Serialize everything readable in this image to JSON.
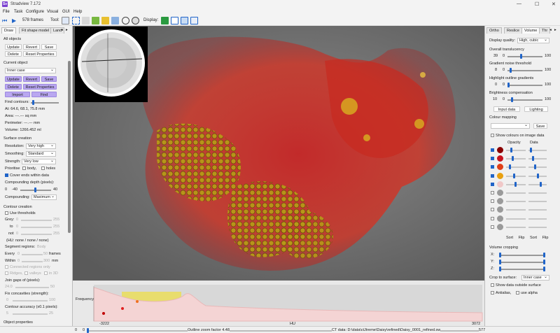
{
  "window": {
    "title": "Stradview 7.172",
    "logo": "Sv"
  },
  "menu": [
    "File",
    "Task",
    "Configure",
    "Visual",
    "GUI",
    "Help"
  ],
  "toolbar": {
    "frames": "578 frames",
    "tool_label": "Tool:",
    "display_label": "Display:"
  },
  "left": {
    "tabs": [
      "Draw",
      "Fit shape model",
      "Land"
    ],
    "all_objects": "All objects",
    "btn_update": "Update",
    "btn_revert": "Revert",
    "btn_save": "Save",
    "btn_delete": "Delete",
    "btn_reset": "Reset Properties",
    "current_object": "Current object",
    "object_select": "Inner case",
    "btn_import": "Import",
    "btn_find": "Find",
    "find_contours": "Find contours:",
    "at": "At: 64.6, 68.1, 75.8 mm",
    "area": "Area: ---.--- sq mm",
    "perimeter": "Perimeter: ---.--- mm",
    "volume": "Volume: 1266.452 ml",
    "surface_creation": "Surface creation",
    "resolution_label": "Resolution:",
    "resolution": "Very high",
    "smoothing_label": "Smoothing:",
    "smoothing": "Standard",
    "strength_label": "Strength:",
    "strength": "Very low",
    "prioritise": "Prioritise",
    "body": "body,",
    "holes": "holes",
    "cover_ends": "Cover ends within data",
    "compounding_depth": "Compounding depth (pixels):",
    "cd_min": "0",
    "cd_left": "-40",
    "cd_right": "40",
    "compounding_label": "Compounding:",
    "compounding": "Maximum",
    "contour_creation": "Contour creation",
    "use_thresholds": "Use thresholds",
    "grey": "Grey:",
    "grey_v": "0",
    "grey_max": "255",
    "to": "to",
    "to_v": "0",
    "to_max": "255",
    "not": "not",
    "not_v": "0",
    "not_max": "255",
    "hu": "(HU:  none / none / none)",
    "segment_regions": "Segment regions:",
    "segment_val": "Body",
    "every": "Every",
    "every_v": "0",
    "every_max": "50",
    "frames_unit": "frames",
    "within": "Within",
    "within_v": "0",
    "within_max": "300",
    "mm_unit": "mm",
    "connected": "Connected regions only",
    "ridges": "Ridges,",
    "valleys": "valleys",
    "in3d": "in 3D",
    "join_gaps": "Join gaps of (pixels):",
    "jg_v": "24.0",
    "jg_max": "50",
    "fix_concav": "Fix concavities (strength):",
    "fc_v": "0",
    "fc_max": "100",
    "contour_acc": "Contour accuracy (x0.1 pixels):",
    "ca_v": "5",
    "ca_max": "25",
    "object_properties": "Object properties"
  },
  "histogram": {
    "label": "Frequency",
    "min": "-3222",
    "mid": "HU",
    "max": "3072"
  },
  "status": {
    "left_a": "0",
    "left_b": "0",
    "zoom": "Outline zoom factor 4.48",
    "ctdata": "CT data: D:\\data\\ctJtreme\\Daisy\\refined\\Daisy_0001_refined.sw",
    "frame": "577"
  },
  "right": {
    "tabs": [
      "Ortho",
      "Reslice",
      "Volume",
      "Thr"
    ],
    "display_quality_label": "Display quality:",
    "display_quality": "High, cubic",
    "overall_translucency": "Overall translucency",
    "ot_v": "39",
    "ot_min": "0",
    "ot_max": "100",
    "gradient_noise": "Gradient noise threshold",
    "gn_v": "8",
    "gn_min": "0",
    "gn_max": "100",
    "highlight_outline": "Highlight outline gradients",
    "ho_v": "0",
    "ho_min": "0",
    "ho_max": "100",
    "brightness_comp": "Brightness compensation",
    "bc_v": "10",
    "bc_min": "0",
    "bc_max": "100",
    "btn_input": "Input data",
    "btn_lighting": "Lighting",
    "colour_mapping": "Colour mapping",
    "btn_save": "Save",
    "show_colours": "Show colours on image data",
    "opacity": "Opacity",
    "data": "Data",
    "sort1": "Sort",
    "flip1": "Flip",
    "sort2": "Sort",
    "flip2": "Flip",
    "volume_cropping": "Volume cropping",
    "x": "X:",
    "y": "Y:",
    "z": "Z:",
    "crop_label": "Crop to surface:",
    "crop_val": "Inner case",
    "show_outside": "Show data outside surface",
    "antialias": "Antialias,",
    "alpha": "use alpha"
  },
  "colors": {
    "accent": "#2064c8",
    "purple": "#b9a7f0",
    "viewport_bg": "#6e6e6e"
  },
  "swatches": [
    "#8a0000",
    "#c8141e",
    "#e04018",
    "#e8a010",
    "#f0c8c8",
    "#9a9a9a",
    "#9a9a9a",
    "#9a9a9a",
    "#9a9a9a",
    "#9a9a9a"
  ]
}
